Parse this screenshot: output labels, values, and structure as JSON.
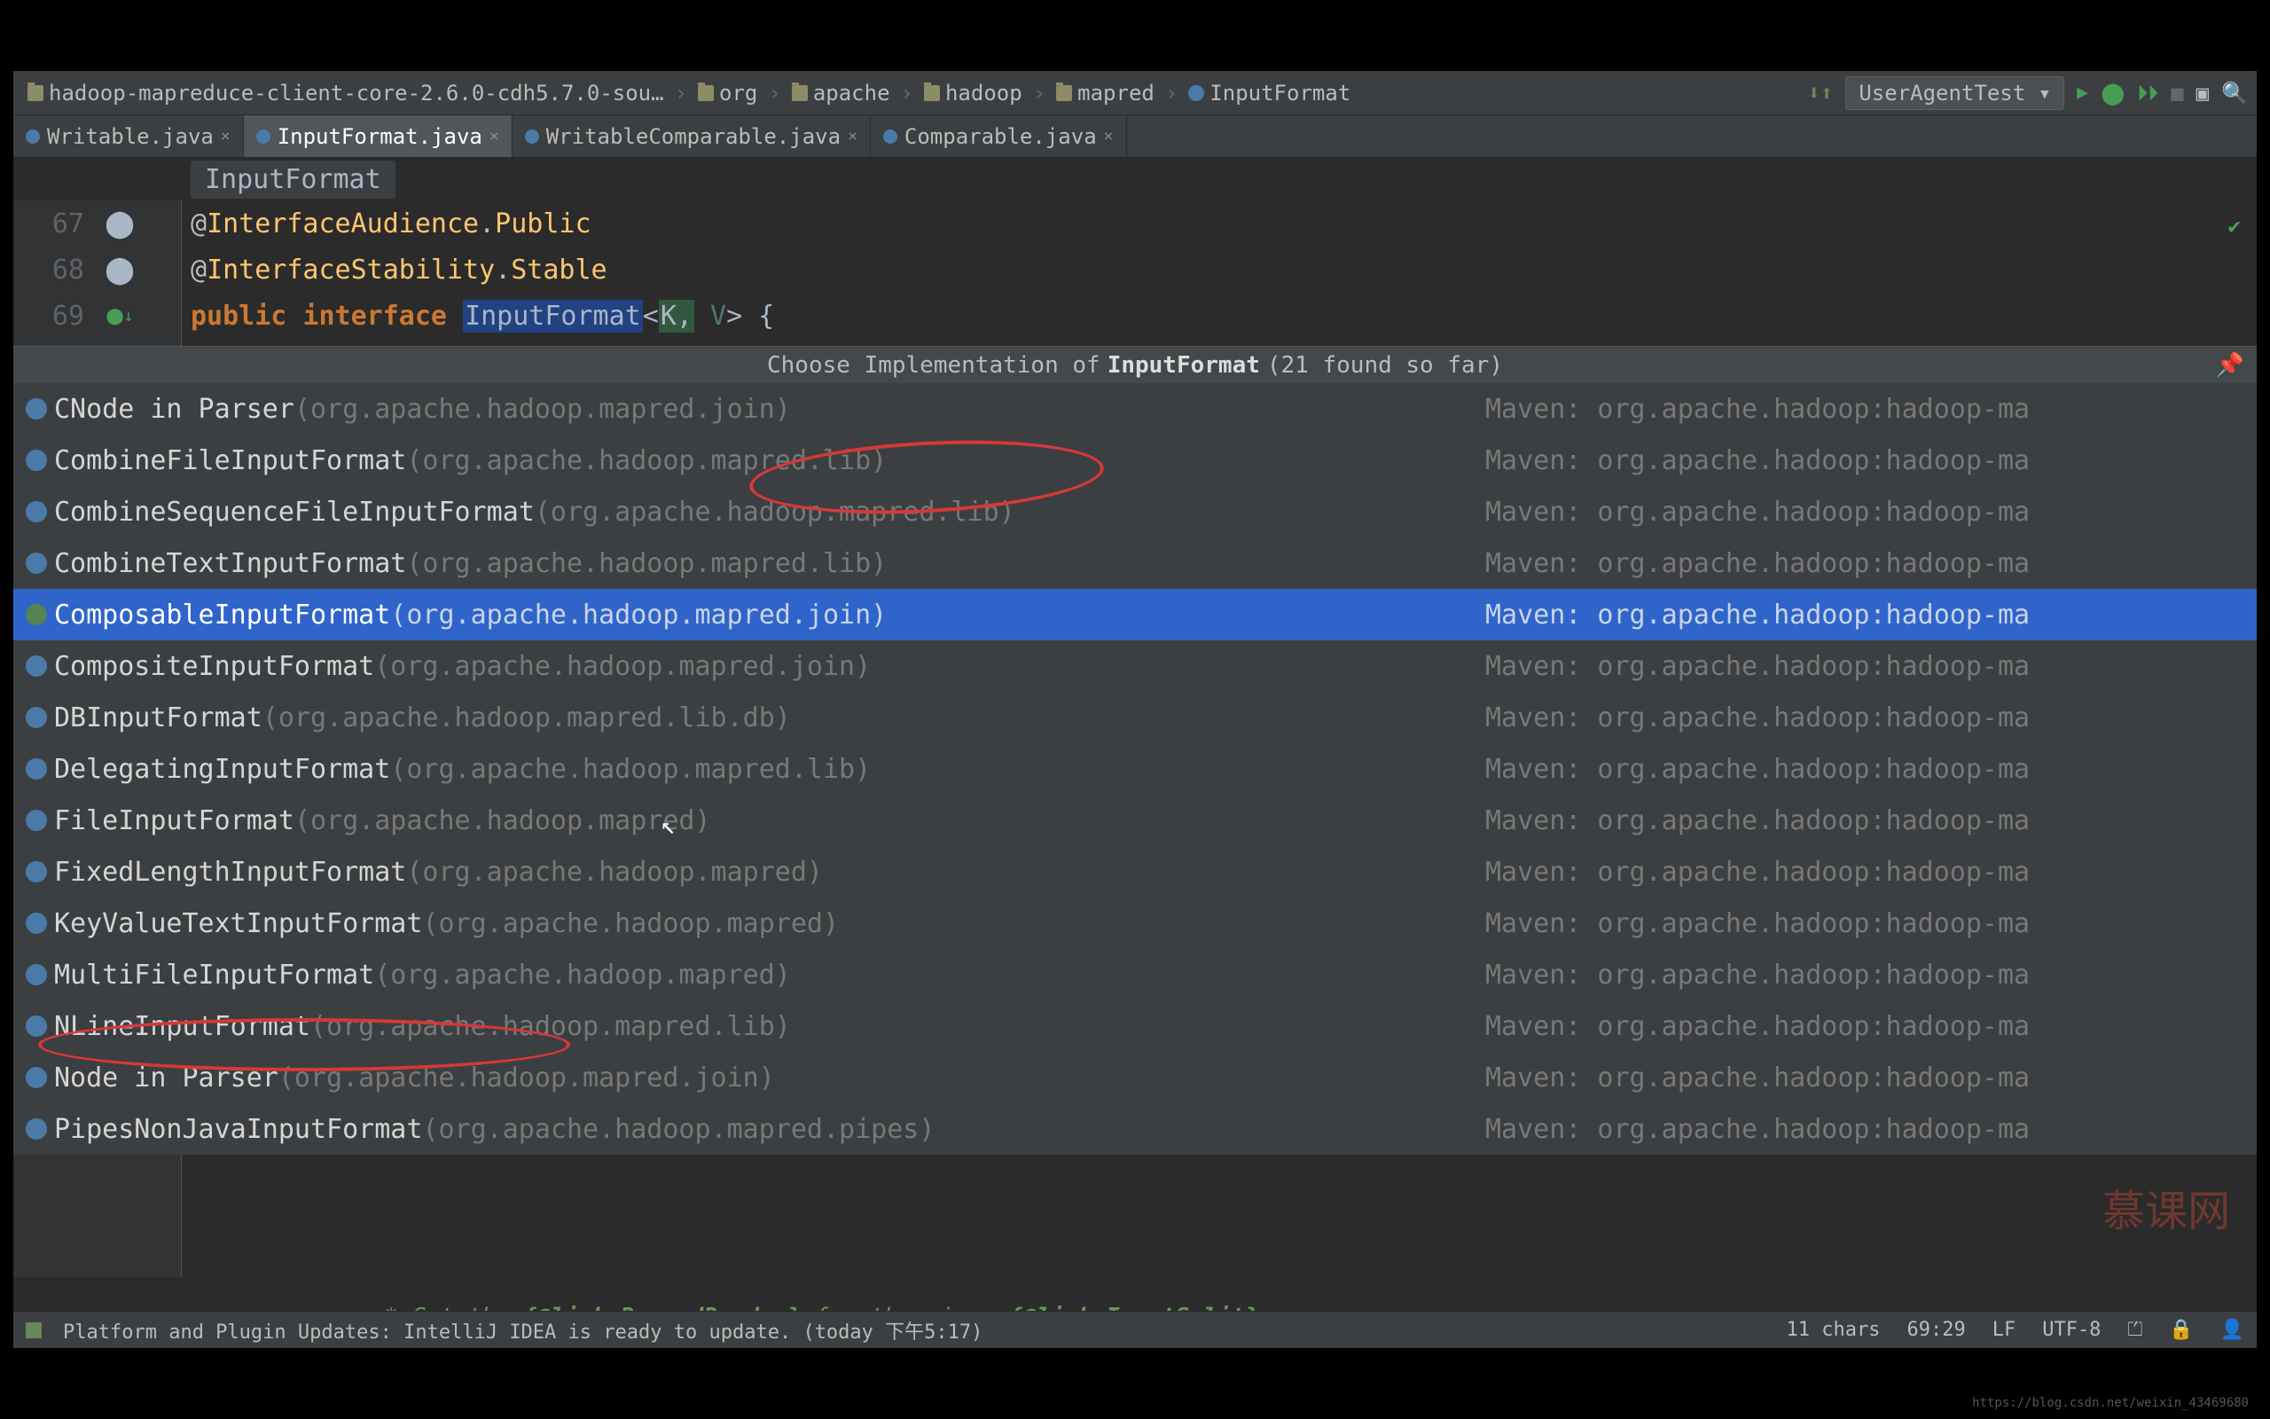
{
  "breadcrumbs": [
    {
      "label": "hadoop-mapreduce-client-core-2.6.0-cdh5.7.0-sou…",
      "type": "folder"
    },
    {
      "label": "org",
      "type": "folder"
    },
    {
      "label": "apache",
      "type": "folder"
    },
    {
      "label": "hadoop",
      "type": "folder"
    },
    {
      "label": "mapred",
      "type": "folder"
    },
    {
      "label": "InputFormat",
      "type": "class"
    }
  ],
  "run_config": "UserAgentTest",
  "tabs": [
    {
      "label": "Writable.java",
      "active": false
    },
    {
      "label": "InputFormat.java",
      "active": true
    },
    {
      "label": "WritableComparable.java",
      "active": false
    },
    {
      "label": "Comparable.java",
      "active": false
    }
  ],
  "sub_breadcrumb": "InputFormat",
  "code": {
    "line67": {
      "num": "67",
      "ann_prefix": "@",
      "ann_cls": "InterfaceAudience",
      "dot": ".",
      "ann_member": "Public"
    },
    "line68": {
      "num": "68",
      "ann_prefix": "@",
      "ann_cls": "InterfaceStability",
      "dot": ".",
      "ann_member": "Stable"
    },
    "line69": {
      "num": "69",
      "kw1": "public",
      "sp1": " ",
      "kw2": "interface",
      "sp2": " ",
      "name": "InputFormat",
      "lt": "<",
      "k": "K,",
      "sp3": " ",
      "v": "V",
      "gt": ">",
      "sp4": " ",
      "brace": "{"
    }
  },
  "popup": {
    "prefix": "Choose Implementation of ",
    "target": "InputFormat",
    "suffix": " (21 found so far)"
  },
  "implementations": [
    {
      "name": "CNode in Parser",
      "pkg": "(org.apache.hadoop.mapred.join)",
      "source": "Maven: org.apache.hadoop:hadoop-ma",
      "icon": "c"
    },
    {
      "name": "CombineFileInputFormat",
      "pkg": "(org.apache.hadoop.mapred.lib)",
      "source": "Maven: org.apache.hadoop:hadoop-ma",
      "icon": "c"
    },
    {
      "name": "CombineSequenceFileInputFormat",
      "pkg": "(org.apache.hadoop.mapred.lib)",
      "source": "Maven: org.apache.hadoop:hadoop-ma",
      "icon": "c"
    },
    {
      "name": "CombineTextInputFormat",
      "pkg": "(org.apache.hadoop.mapred.lib)",
      "source": "Maven: org.apache.hadoop:hadoop-ma",
      "icon": "c"
    },
    {
      "name": "ComposableInputFormat",
      "pkg": "(org.apache.hadoop.mapred.join)",
      "source": "Maven: org.apache.hadoop:hadoop-ma",
      "icon": "i",
      "selected": true
    },
    {
      "name": "CompositeInputFormat",
      "pkg": "(org.apache.hadoop.mapred.join)",
      "source": "Maven: org.apache.hadoop:hadoop-ma",
      "icon": "c"
    },
    {
      "name": "DBInputFormat",
      "pkg": "(org.apache.hadoop.mapred.lib.db)",
      "source": "Maven: org.apache.hadoop:hadoop-ma",
      "icon": "c"
    },
    {
      "name": "DelegatingInputFormat",
      "pkg": "(org.apache.hadoop.mapred.lib)",
      "source": "Maven: org.apache.hadoop:hadoop-ma",
      "icon": "c"
    },
    {
      "name": "FileInputFormat",
      "pkg": "(org.apache.hadoop.mapred)",
      "source": "Maven: org.apache.hadoop:hadoop-ma",
      "icon": "c"
    },
    {
      "name": "FixedLengthInputFormat",
      "pkg": "(org.apache.hadoop.mapred)",
      "source": "Maven: org.apache.hadoop:hadoop-ma",
      "icon": "c"
    },
    {
      "name": "KeyValueTextInputFormat",
      "pkg": "(org.apache.hadoop.mapred)",
      "source": "Maven: org.apache.hadoop:hadoop-ma",
      "icon": "c"
    },
    {
      "name": "MultiFileInputFormat",
      "pkg": "(org.apache.hadoop.mapred)",
      "source": "Maven: org.apache.hadoop:hadoop-ma",
      "icon": "c"
    },
    {
      "name": "NLineInputFormat",
      "pkg": "(org.apache.hadoop.mapred.lib)",
      "source": "Maven: org.apache.hadoop:hadoop-ma",
      "icon": "c"
    },
    {
      "name": "Node in Parser",
      "pkg": "(org.apache.hadoop.mapred.join)",
      "source": "Maven: org.apache.hadoop:hadoop-ma",
      "icon": "c"
    },
    {
      "name": "PipesNonJavaInputFormat",
      "pkg": "(org.apache.hadoop.mapred.pipes)",
      "source": "Maven: org.apache.hadoop:hadoop-ma",
      "icon": "c"
    }
  ],
  "bottom_comment": {
    "pre": " * Get the ",
    "tag1": "{@link RecordReader}",
    "mid": " for the given ",
    "tag2": "{@link InputSplit}",
    "post": "."
  },
  "status": {
    "message": "Platform and Plugin Updates: IntelliJ IDEA is ready to update. (today 下午5:17)",
    "chars": "11 chars",
    "pos": "69:29",
    "line_sep": "LF",
    "encoding": "UTF-8",
    "insert": "⏍"
  },
  "watermark": "慕课网",
  "footer_wm": "https://blog.csdn.net/weixin_43469680"
}
